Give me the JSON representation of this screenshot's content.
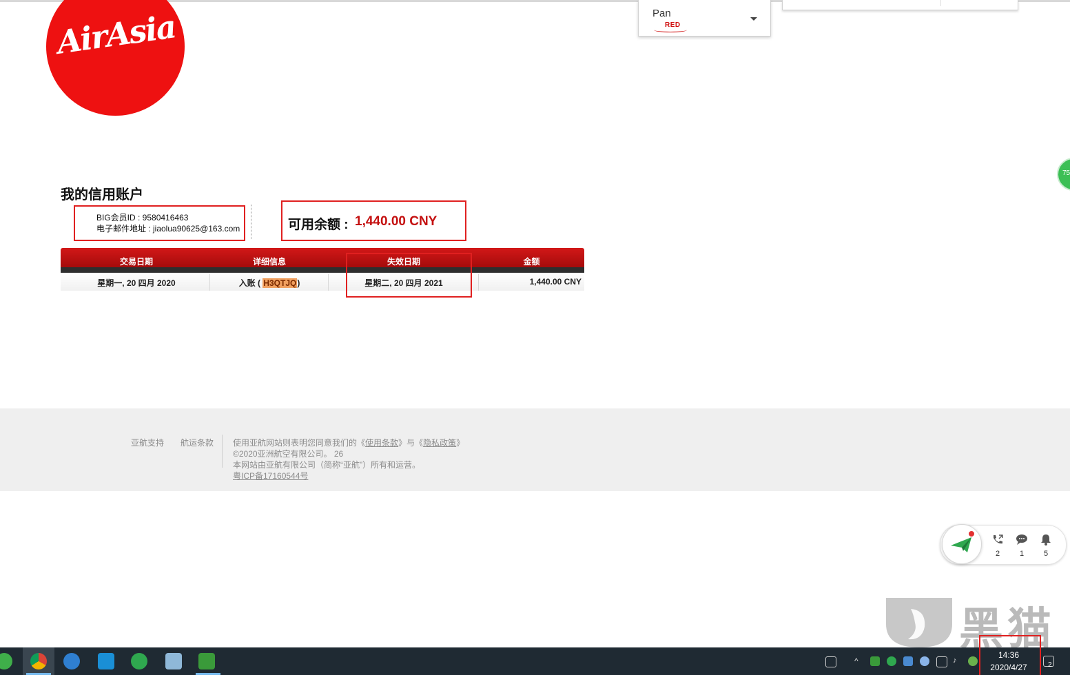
{
  "logo": {
    "text": "AirAsia"
  },
  "user_menu": {
    "name": "Pan",
    "tier": "RED"
  },
  "side_badge": {
    "text": "75"
  },
  "account": {
    "title": "我的信用账户",
    "member_id_line": "BIG会员ID : 9580416463",
    "email_line": "电子邮件地址 : jiaolua90625@163.com",
    "balance_label": "可用余额 :",
    "balance_value": "1,440.00  CNY"
  },
  "table": {
    "headers": [
      "交易日期",
      "详细信息",
      "失效日期",
      "金额"
    ],
    "rows": [
      {
        "date": "星期一, 20 四月 2020",
        "detail_prefix": "入账 ( ",
        "booking_code": "H3QTJQ",
        "detail_suffix": ")",
        "expiry": "星期二, 20 四月 2021",
        "amount": "1,440.00 CNY"
      }
    ]
  },
  "footer": {
    "links": [
      "亚航支持",
      "航运条款"
    ],
    "terms_prefix": "使用亚航网站则表明您同意我们的《",
    "terms_link": "使用条款",
    "terms_mid": "》与《",
    "privacy_link": "隐私政策",
    "terms_suffix": "》",
    "copyright": "©2020亚洲航空有限公司。 26",
    "operated_by": "本网站由亚航有限公司（简称“亚航”）所有和运营。",
    "icp": "粤ICP备17160544号"
  },
  "chat_widget": {
    "items": [
      {
        "icon": "phone-icon",
        "count": "2"
      },
      {
        "icon": "chat-bubble-icon",
        "count": "1"
      },
      {
        "icon": "bell-icon",
        "count": "5"
      }
    ]
  },
  "watermark": {
    "text": "黑猫"
  },
  "taskbar": {
    "time": "14:36",
    "date": "2020/4/27",
    "notification_count": "2",
    "pinned": [
      "start-icon",
      "chrome-icon",
      "browser-icon",
      "u-app-icon",
      "messenger-icon",
      "document-icon",
      "rocket-app-icon"
    ]
  },
  "colors": {
    "brand_red": "#ee1111",
    "highlight_box": "#e02020",
    "taskbar": "#1f2a33"
  }
}
